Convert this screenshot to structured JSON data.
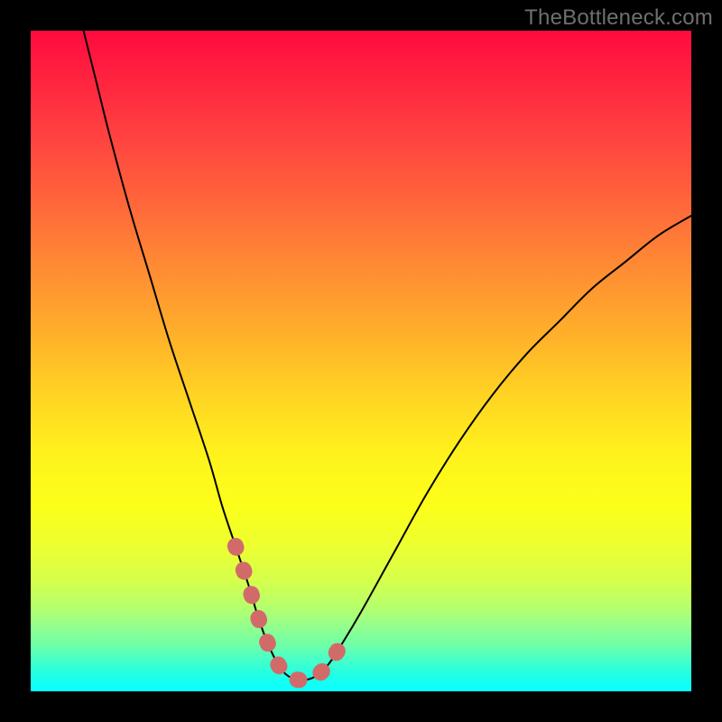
{
  "watermark": "TheBottleneck.com",
  "chart_data": {
    "type": "line",
    "title": "",
    "xlabel": "",
    "ylabel": "",
    "xlim": [
      0,
      100
    ],
    "ylim": [
      0,
      100
    ],
    "grid": false,
    "series": [
      {
        "name": "main-curve",
        "color": "#000000",
        "stroke_width": 2,
        "x": [
          8,
          10,
          12,
          15,
          18,
          21,
          24,
          27,
          29,
          31,
          33,
          34.5,
          36,
          37.5,
          39,
          41,
          43,
          45,
          47,
          50,
          55,
          60,
          65,
          70,
          75,
          80,
          85,
          90,
          95,
          100
        ],
        "y": [
          100,
          92,
          84,
          73,
          63,
          53,
          44,
          35,
          28,
          22,
          16,
          11,
          7,
          4,
          2.3,
          1.7,
          2.2,
          4,
          7,
          12,
          21,
          30,
          38,
          45,
          51,
          56,
          61,
          65,
          69,
          72
        ]
      },
      {
        "name": "highlight-segment",
        "color": "#d36a6a",
        "stroke_width": 11,
        "dashed": true,
        "x": [
          31,
          33,
          34.5,
          36,
          37.5,
          39,
          41,
          43,
          45,
          47
        ],
        "y": [
          22,
          16,
          11,
          7,
          4,
          2.3,
          1.7,
          2.2,
          4,
          7
        ]
      }
    ],
    "background_gradient": {
      "orientation": "vertical",
      "stops": [
        {
          "pos": 0.0,
          "color": "#ff0a3f"
        },
        {
          "pos": 0.5,
          "color": "#ffd323"
        },
        {
          "pos": 0.75,
          "color": "#fcff1a"
        },
        {
          "pos": 1.0,
          "color": "#0affff"
        }
      ]
    }
  }
}
